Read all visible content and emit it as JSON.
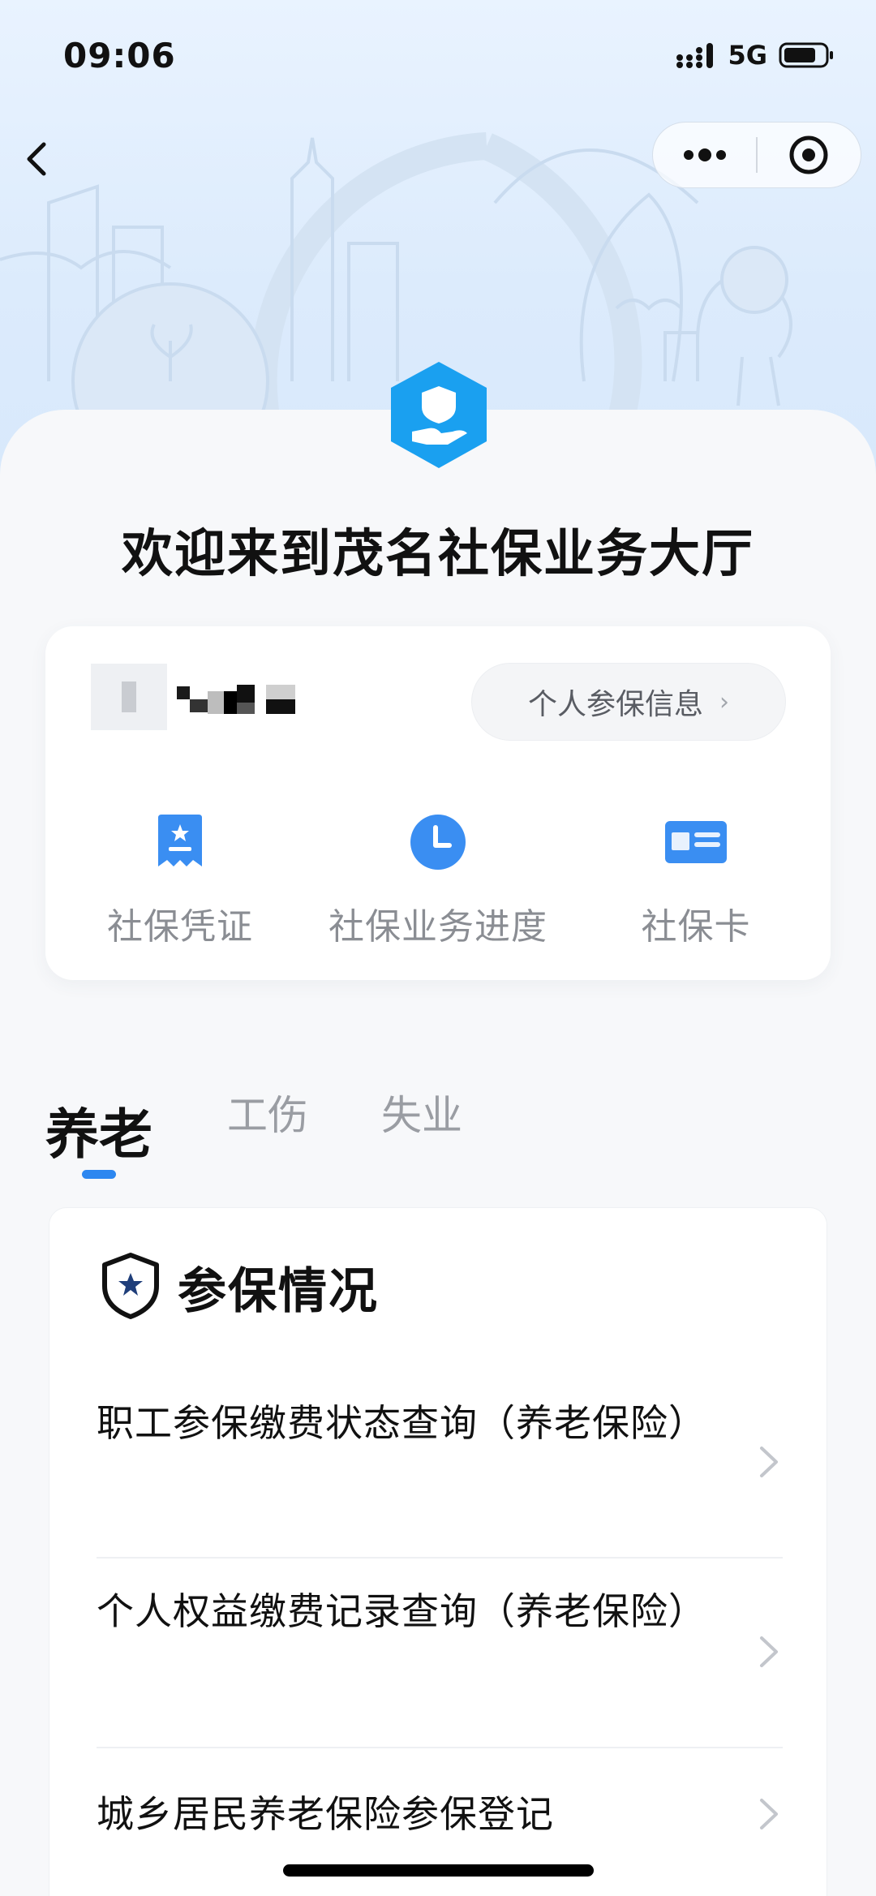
{
  "status_bar": {
    "time": "09:06",
    "network": "5G"
  },
  "colors": {
    "accent": "#2d87f0",
    "logo": "#1aa0f0",
    "tab_indicator": "#2d87f0"
  },
  "header": {
    "title": "欢迎来到茂名社保业务大厅"
  },
  "user_card": {
    "info_button": "个人参保信息",
    "quick_actions": [
      {
        "label": "社保凭证",
        "icon": "certificate-ribbon-icon"
      },
      {
        "label": "社保业务进度",
        "icon": "clock-icon"
      },
      {
        "label": "社保卡",
        "icon": "id-card-icon"
      }
    ]
  },
  "tabs": [
    {
      "label": "养老",
      "active": true
    },
    {
      "label": "工伤",
      "active": false
    },
    {
      "label": "失业",
      "active": false
    }
  ],
  "section": {
    "title": "参保情况",
    "icon": "shield-star-icon",
    "items": [
      {
        "label": "职工参保缴费状态查询（养老保险）"
      },
      {
        "label": "个人权益缴费记录查询（养老保险）"
      },
      {
        "label": "城乡居民养老保险参保登记"
      }
    ]
  }
}
